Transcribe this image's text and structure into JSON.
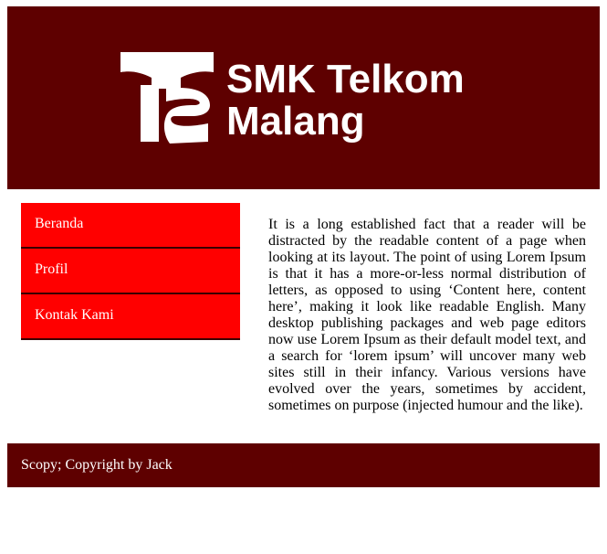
{
  "header": {
    "logo_icon": "telkom-ts-logo",
    "title_line1": "SMK Telkom",
    "title_line2": "Malang"
  },
  "nav": {
    "items": [
      {
        "label": "Beranda"
      },
      {
        "label": "Profil"
      },
      {
        "label": "Kontak Kami"
      }
    ]
  },
  "content": {
    "paragraph": "It is a long established fact that a reader will be distracted by the readable content of a page when looking at its layout. The point of using Lorem Ipsum is that it has a more-or-less normal distribution of letters, as opposed to using ‘Content here, content here’, making it look like readable English. Many desktop publishing packages and web page editors now use Lorem Ipsum as their default model text, and a search for ‘lorem ipsum’ will uncover many web sites still in their infancy. Various versions have evolved over the years, sometimes by accident, sometimes on purpose (injected humour and the like)."
  },
  "footer": {
    "text": "Scopy; Copyright by Jack"
  },
  "colors": {
    "header_bg": "#5e0000",
    "nav_bg": "#ff0000",
    "footer_bg": "#5e0000",
    "text_light": "#ffffff"
  }
}
